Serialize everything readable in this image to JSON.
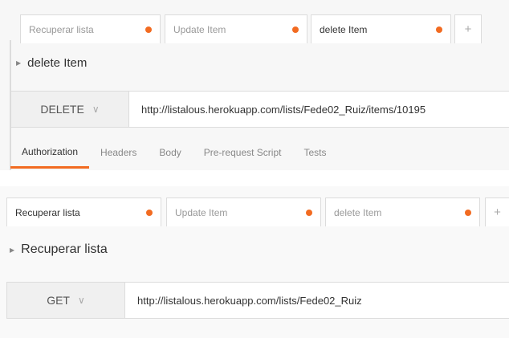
{
  "colors": {
    "accent": "#f26b21"
  },
  "top": {
    "tabs": [
      {
        "label": "Recuperar lista",
        "unsaved": true
      },
      {
        "label": "Update Item",
        "unsaved": true
      },
      {
        "label": "delete Item",
        "unsaved": true,
        "active": true
      }
    ],
    "add_tab": "+",
    "request_title": "delete Item",
    "method": "DELETE",
    "url": "http://listalous.herokuapp.com/lists/Fede02_Ruiz/items/10195",
    "subtabs": [
      "Authorization",
      "Headers",
      "Body",
      "Pre-request Script",
      "Tests"
    ],
    "active_subtab": "Authorization"
  },
  "bottom": {
    "tabs": [
      {
        "label": "Recuperar lista",
        "unsaved": true,
        "active": true
      },
      {
        "label": "Update Item",
        "unsaved": true
      },
      {
        "label": "delete Item",
        "unsaved": true
      }
    ],
    "add_tab": "+",
    "request_title": "Recuperar lista",
    "method": "GET",
    "url": "http://listalous.herokuapp.com/lists/Fede02_Ruiz"
  }
}
